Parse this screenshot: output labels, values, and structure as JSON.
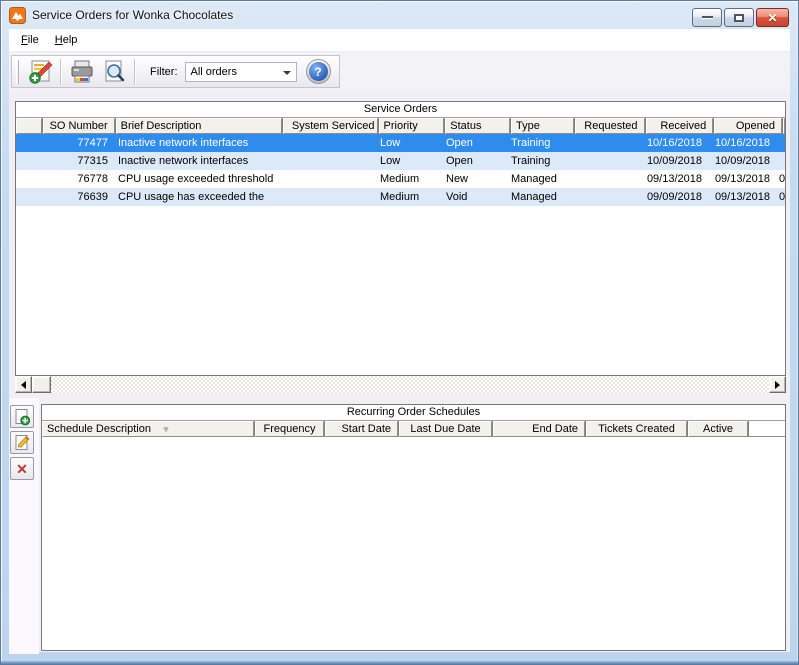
{
  "window": {
    "title": "Service Orders for Wonka Chocolates"
  },
  "menu": {
    "items": [
      {
        "accel": "F",
        "rest": "ile"
      },
      {
        "accel": "H",
        "rest": "elp"
      }
    ]
  },
  "toolbar": {
    "filter_label": "Filter:",
    "filter_value": "All orders",
    "help_glyph": "?"
  },
  "service_orders": {
    "caption": "Service Orders",
    "columns": {
      "selector": "",
      "so_number": "SO Number",
      "description": "Brief Description",
      "system_serviced": "System Serviced",
      "priority": "Priority",
      "status": "Status",
      "type": "Type",
      "requested": "Requested",
      "received": "Received",
      "opened": "Opened"
    },
    "rows": [
      {
        "so_number": "77477",
        "description": "Inactive network interfaces",
        "system_serviced": "",
        "priority": "Low",
        "status": "Open",
        "type": "Training",
        "requested": "",
        "received": "10/16/2018",
        "opened": "10/16/2018",
        "overflow": ""
      },
      {
        "so_number": "77315",
        "description": "Inactive network interfaces",
        "system_serviced": "",
        "priority": "Low",
        "status": "Open",
        "type": "Training",
        "requested": "",
        "received": "10/09/2018",
        "opened": "10/09/2018",
        "overflow": ""
      },
      {
        "so_number": "76778",
        "description": "CPU usage exceeded threshold",
        "system_serviced": "",
        "priority": "Medium",
        "status": "New",
        "type": "Managed",
        "requested": "",
        "received": "09/13/2018",
        "opened": "09/13/2018",
        "overflow": "0"
      },
      {
        "so_number": "76639",
        "description": "CPU usage has exceeded the",
        "system_serviced": "",
        "priority": "Medium",
        "status": "Void",
        "type": "Managed",
        "requested": "",
        "received": "09/09/2018",
        "opened": "09/13/2018",
        "overflow": "0"
      }
    ]
  },
  "recurring": {
    "caption": "Recurring Order Schedules",
    "columns": {
      "description": "Schedule Description",
      "frequency": "Frequency",
      "start_date": "Start Date",
      "last_due_date": "Last Due Date",
      "end_date": "End Date",
      "tickets_created": "Tickets Created",
      "active": "Active"
    },
    "rows": []
  },
  "colors": {
    "selected_row": "#2f8cef",
    "alt_row": "#dce9f8",
    "titlebar_frame": "#c6daf1",
    "close_button": "#d8573d",
    "header_cell": "#f2f1ec",
    "app_icon_orange": "#f07818"
  }
}
